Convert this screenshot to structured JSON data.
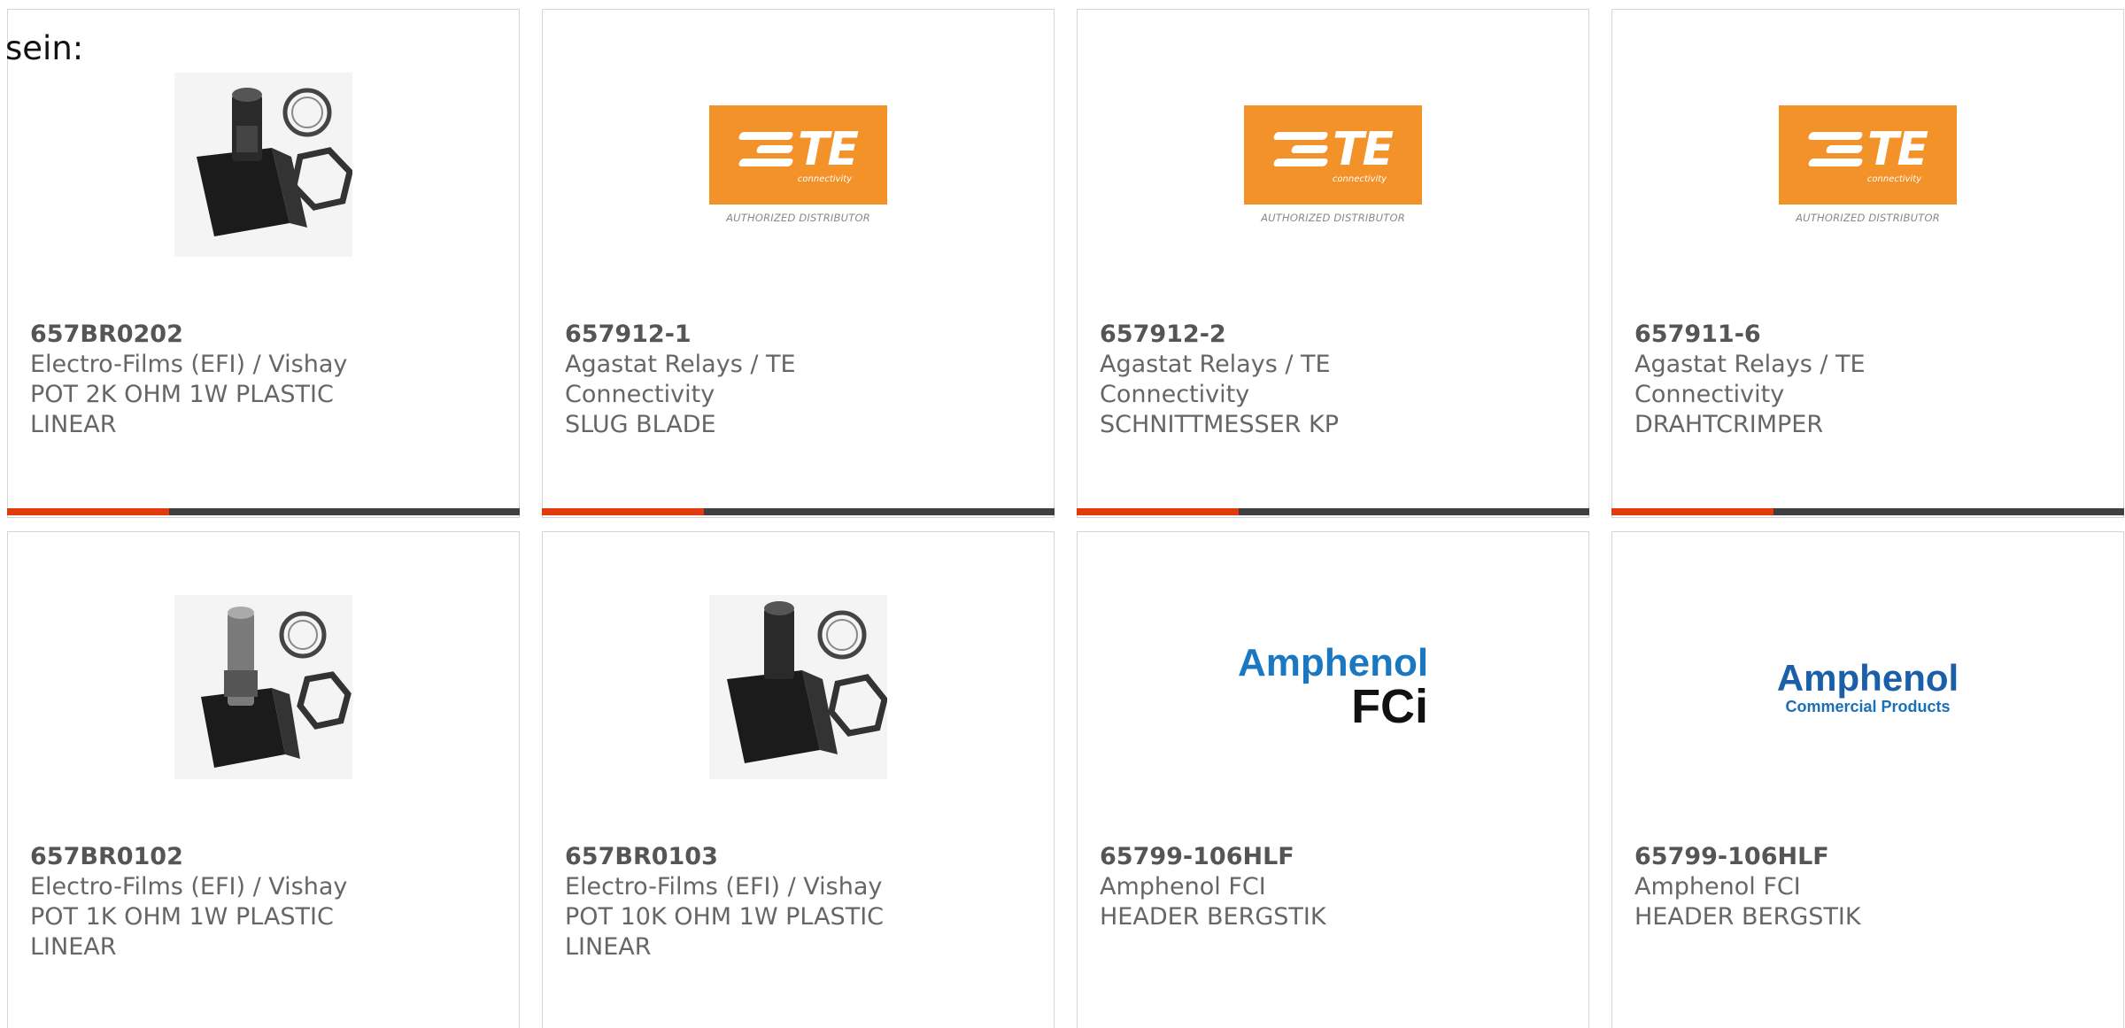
{
  "intro_text": "sein:",
  "colors": {
    "accent": "#e03a0e",
    "bar": "#3f3f3f",
    "te_orange": "#f39228",
    "amphenol_blue": "#1a78c2"
  },
  "logos": {
    "te": {
      "name": "TE",
      "sub": "connectivity",
      "auth": "AUTHORIZED DISTRIBUTOR"
    },
    "amphenol_fci": {
      "name": "Amphenol",
      "sub": "FCi"
    },
    "amphenol_cp": {
      "name": "Amphenol",
      "sub": "Commercial Products"
    }
  },
  "products": [
    {
      "part": "657BR0202",
      "manufacturer": "Electro-Films (EFI) / Vishay",
      "desc1": "POT 2K OHM 1W PLASTIC",
      "desc2": "LINEAR",
      "image": "potentiometer-photo"
    },
    {
      "part": "657912-1",
      "manufacturer": "Agastat Relays / TE Connectivity",
      "desc1": "SLUG BLADE",
      "desc2": "",
      "image": "te-logo"
    },
    {
      "part": "657912-2",
      "manufacturer": "Agastat Relays / TE Connectivity",
      "desc1": "SCHNITTMESSER KP",
      "desc2": "",
      "image": "te-logo"
    },
    {
      "part": "657911-6",
      "manufacturer": "Agastat Relays / TE Connectivity",
      "desc1": "DRAHTCRIMPER",
      "desc2": "",
      "image": "te-logo"
    },
    {
      "part": "657BR0102",
      "manufacturer": "Electro-Films (EFI) / Vishay",
      "desc1": "POT 1K OHM 1W PLASTIC",
      "desc2": "LINEAR",
      "image": "potentiometer-photo"
    },
    {
      "part": "657BR0103",
      "manufacturer": "Electro-Films (EFI) / Vishay",
      "desc1": "POT 10K OHM 1W PLASTIC",
      "desc2": "LINEAR",
      "image": "potentiometer-photo"
    },
    {
      "part": "65799-106HLF",
      "manufacturer": "Amphenol FCI",
      "desc1": "HEADER BERGSTIK",
      "desc2": "",
      "image": "amphenol-fci-logo"
    },
    {
      "part": "65799-106HLF",
      "manufacturer": "Amphenol FCI",
      "desc1": "HEADER BERGSTIK",
      "desc2": "",
      "image": "amphenol-commercial-logo"
    }
  ]
}
